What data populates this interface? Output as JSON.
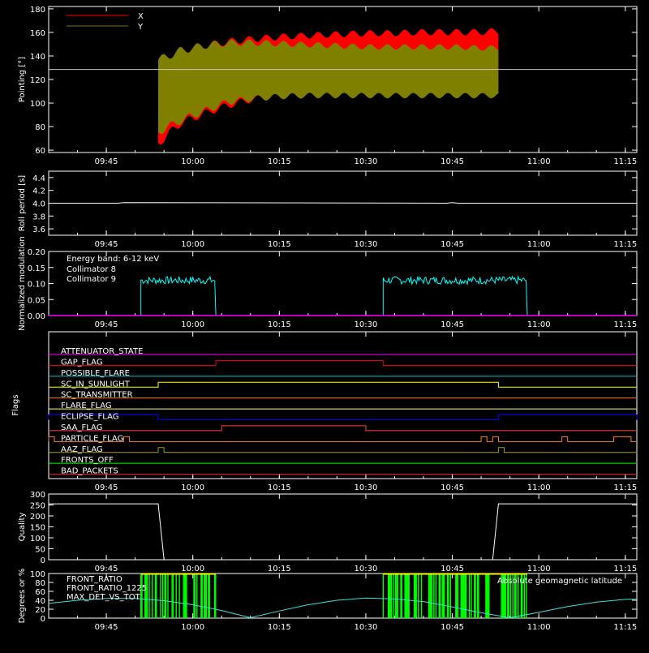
{
  "time_axis": {
    "start": "09:35",
    "end": "11:17",
    "tick_labels": [
      "09:45",
      "10:00",
      "10:15",
      "10:30",
      "10:45",
      "11:00",
      "11:15"
    ]
  },
  "chart_data": [
    {
      "type": "area",
      "ylabel": "Pointing [°]",
      "ylim": [
        58,
        182
      ],
      "yticks": [
        60,
        80,
        100,
        120,
        140,
        160,
        180
      ],
      "legend": "top-left",
      "reference_line": 128.5,
      "series": [
        {
          "name": "X",
          "color": "#ff0000",
          "x": [
            "09:54",
            "09:58",
            "10:02",
            "10:06",
            "10:10",
            "10:15",
            "10:20",
            "10:25",
            "10:30",
            "10:35",
            "10:40",
            "10:45",
            "10:50",
            "10:53"
          ],
          "upper": [
            140,
            148,
            152,
            155,
            157,
            159,
            160,
            161,
            162,
            162,
            163,
            163,
            163,
            164
          ],
          "lower": [
            62,
            80,
            88,
            95,
            100,
            104,
            107,
            108,
            108,
            108,
            108,
            108,
            108,
            108
          ]
        },
        {
          "name": "Y",
          "color": "#808000",
          "x": [
            "09:54",
            "09:58",
            "10:02",
            "10:06",
            "10:10",
            "10:15",
            "10:20",
            "10:25",
            "10:30",
            "10:35",
            "10:40",
            "10:45",
            "10:50",
            "10:53"
          ],
          "upper": [
            140,
            148,
            152,
            154,
            154,
            153,
            152,
            151,
            150,
            150,
            150,
            150,
            149,
            149
          ],
          "lower": [
            72,
            82,
            90,
            98,
            101,
            103,
            104,
            104,
            104,
            104,
            104,
            104,
            104,
            104
          ]
        }
      ]
    },
    {
      "type": "line",
      "ylabel": "Roll period [s]",
      "ylim": [
        3.5,
        4.5
      ],
      "yticks": [
        3.6,
        3.8,
        4.0,
        4.2,
        4.4
      ],
      "series": [
        {
          "name": "",
          "color": "#ffffff",
          "x": [
            "09:35",
            "09:47",
            "09:48",
            "10:44",
            "10:45",
            "10:46",
            "11:17"
          ],
          "values": [
            4.0,
            4.0,
            4.01,
            4.0,
            4.01,
            4.0,
            4.0
          ]
        }
      ]
    },
    {
      "type": "line",
      "ylabel": "Normalized modulation",
      "ylim": [
        0,
        0.2
      ],
      "yticks": [
        0.0,
        0.05,
        0.1,
        0.15,
        0.2
      ],
      "legend": "top-left",
      "annotation": "Energy band: 6-12 keV",
      "series": [
        {
          "name": "Collimator 8",
          "color": "#00ffff",
          "segments": [
            [
              "09:51",
              "10:04"
            ],
            [
              "10:33",
              "10:58"
            ]
          ],
          "mean": 0.11,
          "spread": 0.012
        },
        {
          "name": "Collimator 9",
          "color": "#ff00ff",
          "x": [
            "09:35",
            "11:17"
          ],
          "values": [
            0,
            0
          ]
        }
      ]
    },
    {
      "type": "line",
      "ylabel": "Flags",
      "series": [
        {
          "name": "ATTENUATOR_STATE",
          "color": "#ff00ff",
          "steps": []
        },
        {
          "name": "SAA_FLAG",
          "color": "#ff4040",
          "steps": [
            [
              "10:05",
              "10:30"
            ]
          ]
        },
        {
          "name": "SC_IN_SUNLIGHT",
          "color": "#ffff00",
          "steps": [
            [
              "09:54",
              "10:53"
            ]
          ]
        },
        {
          "name": "ECLIPSE_FLAG",
          "color": "#0000ff",
          "steps": [
            [
              "09:35",
              "09:54"
            ],
            [
              "10:53",
              "11:17"
            ]
          ]
        },
        {
          "name": "GAP_FLAG",
          "color": "#ff0000",
          "steps": [
            [
              "10:04",
              "10:33"
            ]
          ]
        },
        {
          "name": "POSSIBLE_FLARE",
          "color": "#00c0c0",
          "steps": []
        },
        {
          "name": "SC_TRANSMITTER",
          "color": "#ff8000",
          "steps": []
        },
        {
          "name": "FLARE_FLAG",
          "color": "#ffff80",
          "steps": []
        },
        {
          "name": "PARTICLE_FLAG",
          "color": "#ff8030",
          "steps": [
            [
              "09:35",
              "09:36"
            ],
            [
              "09:48",
              "09:49"
            ],
            [
              "10:50",
              "10:51"
            ],
            [
              "10:52",
              "10:53"
            ],
            [
              "11:04",
              "11:05"
            ],
            [
              "11:13",
              "11:16"
            ]
          ]
        },
        {
          "name": "AAZ_FLAG",
          "color": "#a0a000",
          "steps": [
            [
              "09:54",
              "09:55"
            ],
            [
              "10:53",
              "10:54"
            ]
          ]
        },
        {
          "name": "FRONTS_OFF",
          "color": "#00ff00",
          "steps": []
        },
        {
          "name": "BAD_PACKETS",
          "color": "#ff2020",
          "steps": []
        }
      ]
    },
    {
      "type": "line",
      "ylabel": "Quality",
      "ylim": [
        0,
        300
      ],
      "yticks": [
        0,
        50,
        100,
        150,
        200,
        250,
        300
      ],
      "series": [
        {
          "name": "",
          "color": "#ffffff",
          "x": [
            "09:35",
            "09:54",
            "09:55",
            "10:52",
            "10:53",
            "11:17"
          ],
          "values": [
            255,
            255,
            0,
            0,
            255,
            255
          ]
        }
      ]
    },
    {
      "type": "line",
      "ylabel": "Degrees or %",
      "ylim": [
        0,
        100
      ],
      "yticks": [
        0,
        20,
        40,
        60,
        80,
        100
      ],
      "legend": "top-left",
      "series": [
        {
          "name": "FRONT_RATIO",
          "color": "#ffff00",
          "segments": [
            [
              "09:51",
              "10:04"
            ],
            [
              "10:33",
              "10:58"
            ]
          ]
        },
        {
          "name": "FRONT_RATIO_1225",
          "color": "#00ff00",
          "segments": [
            [
              "09:51",
              "10:04"
            ],
            [
              "10:33",
              "10:58"
            ]
          ]
        },
        {
          "name": "MAX_DET_VS_TOT",
          "color": "#ff8000",
          "values": []
        },
        {
          "name": "Absolute geomagnetic latitude",
          "color": "#40e0e0",
          "x": [
            "09:35",
            "09:40",
            "09:45",
            "09:50",
            "09:55",
            "10:00",
            "10:05",
            "10:10",
            "10:15",
            "10:20",
            "10:25",
            "10:30",
            "10:35",
            "10:40",
            "10:45",
            "10:50",
            "10:55",
            "11:00",
            "11:05",
            "11:10",
            "11:15",
            "11:17"
          ],
          "values": [
            33,
            40,
            44,
            44,
            39,
            30,
            17,
            1,
            16,
            30,
            40,
            45,
            43,
            37,
            25,
            12,
            1,
            13,
            26,
            36,
            42,
            43
          ]
        }
      ]
    }
  ]
}
